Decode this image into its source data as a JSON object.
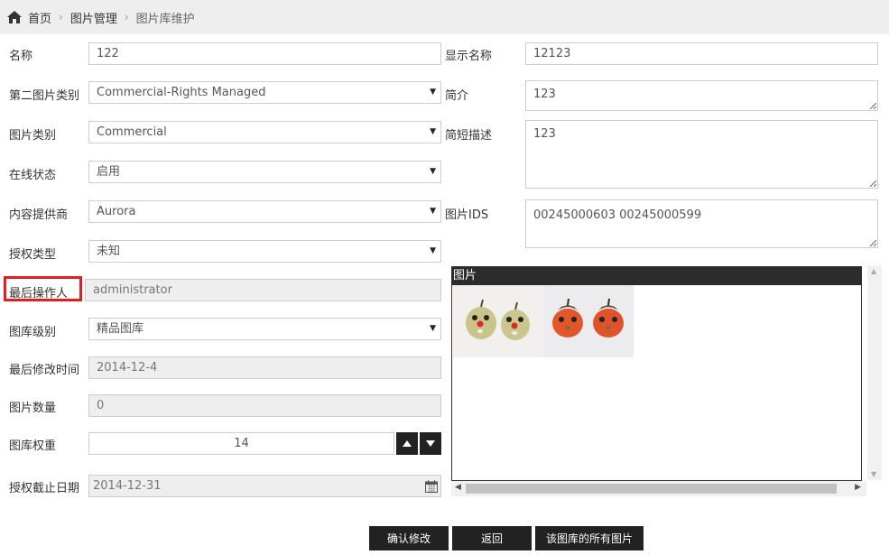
{
  "breadcrumb": {
    "home": "首页",
    "section": "图片管理",
    "current": "图片库维护"
  },
  "left": {
    "name_label": "名称",
    "name_value": "122",
    "second_category_label": "第二图片类别",
    "second_category_value": "Commercial-Rights Managed",
    "category_label": "图片类别",
    "category_value": "Commercial",
    "online_label": "在线状态",
    "online_value": "启用",
    "provider_label": "内容提供商",
    "provider_value": "Aurora",
    "license_label": "授权类型",
    "license_value": "未知",
    "last_operator_label": "最后操作人",
    "last_operator_value": "administrator",
    "level_label": "图库级别",
    "level_value": "精品图库",
    "last_modified_label": "最后修改时间",
    "last_modified_value": "2014-12-4",
    "count_label": "图片数量",
    "count_value": "0",
    "weight_label": "图库权重",
    "weight_value": "14",
    "expiry_label": "授权截止日期",
    "expiry_value": "2014-12-31"
  },
  "right": {
    "display_name_label": "显示名称",
    "display_name_value": "12123",
    "intro_label": "简介",
    "intro_value": "123",
    "short_desc_label": "简短描述",
    "short_desc_value": "123",
    "ids_label": "图片IDS",
    "ids_value": "00245000603  00245000599",
    "panel_title": "图片"
  },
  "buttons": {
    "confirm": "确认修改",
    "back": "返回",
    "all_images": "该图库的所有图片"
  },
  "colors": {
    "highlight": "#e0201f",
    "button_bg": "#222222"
  }
}
